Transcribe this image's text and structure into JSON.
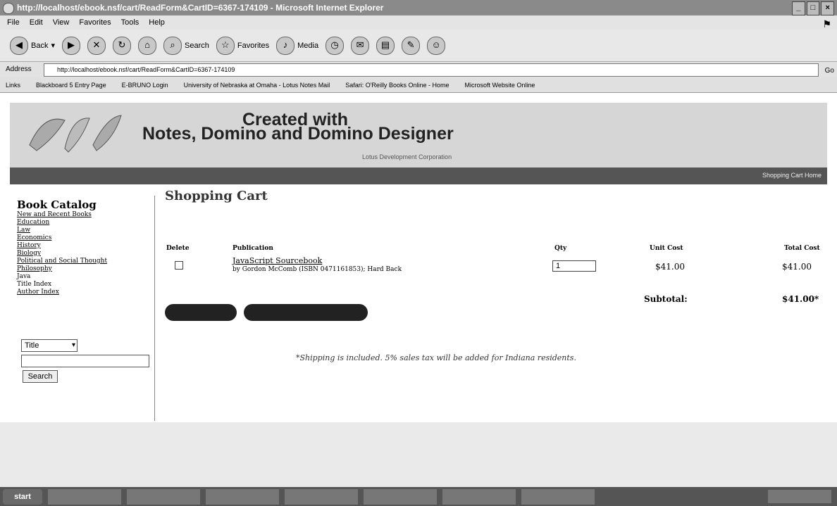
{
  "window": {
    "title": "http://localhost/ebook.nsf/cart/ReadForm&CartID=6367-174109 - Microsoft Internet Explorer",
    "controls": [
      "_",
      "□",
      "×"
    ]
  },
  "menu": [
    "File",
    "Edit",
    "View",
    "Favorites",
    "Tools",
    "Help"
  ],
  "toolbar": {
    "back": "Back",
    "search": "Search",
    "favorites": "Favorites",
    "media": "Media"
  },
  "address": {
    "label": "Address",
    "url": "http://localhost/ebook.nsf/cart/ReadForm&CartID=6367-174109",
    "go": "Go"
  },
  "links_bar": {
    "label": "Links",
    "items": [
      "Blackboard 5 Entry Page",
      "E-BRUNO Login",
      "University of Nebraska at Omaha - Lotus Notes Mail",
      "Safari: O'Reilly Books Online - Home",
      "Microsoft Website Online"
    ]
  },
  "banner": {
    "line1": "Created with",
    "line2": "Notes, Domino and Domino Designer",
    "sub": "Lotus Development Corporation",
    "links": "Shopping Cart   Home"
  },
  "sidebar": {
    "heading": "Book Catalog",
    "links": [
      "New and Recent Books",
      "Education",
      "Law",
      "Economics",
      "History",
      "Biology",
      "Political and Social Thought",
      "Philosophy",
      "Java",
      "Title Index",
      "Author Index"
    ],
    "search_field": "Title",
    "search_button": "Search"
  },
  "cart": {
    "title": "Shopping Cart",
    "columns": [
      "Delete",
      "Publication",
      "Qty",
      "Unit Cost",
      "Total Cost"
    ],
    "item": {
      "title": "JavaScript Sourcebook",
      "detail": "by Gordon McComb (ISBN 0471161853); Hard Back",
      "qty": "1",
      "unit_cost": "$41.00",
      "total_cost": "$41.00"
    },
    "subtotal_label": "Subtotal:",
    "subtotal_value": "$41.00*",
    "note": "*Shipping is included. 5% sales tax will be added for Indiana residents."
  },
  "taskbar": {
    "start": "start"
  }
}
